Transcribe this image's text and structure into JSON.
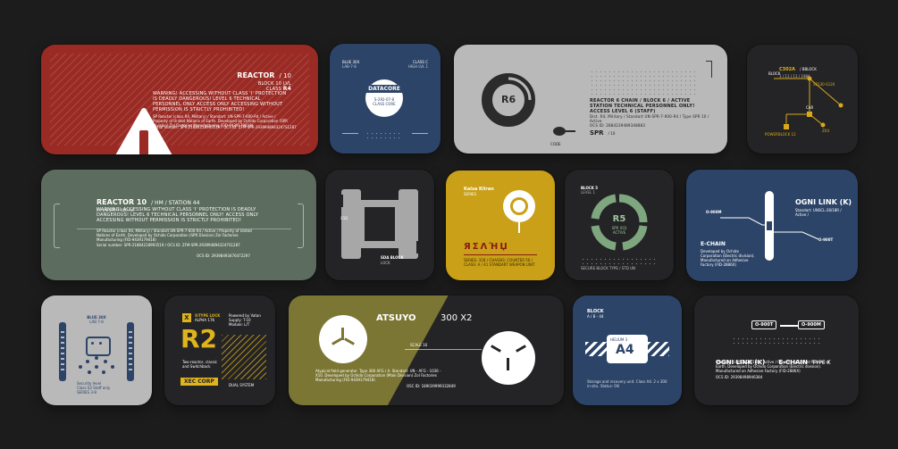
{
  "colors": {
    "background": "#1c1c1d",
    "red": "#9a2a24",
    "navy": "#2c4468",
    "gray": "#b9b9b9",
    "dark": "#242426",
    "green": "#5c6c5e",
    "yellow": "#c9a017",
    "olive": "#7b7633",
    "white": "#ffffff"
  },
  "card1": {
    "title": "REACTOR",
    "title_num": "/ 10",
    "sub1": "BLOCK 10 LVL",
    "sub2": "CLASS",
    "class_val": "R4",
    "warning": "WARNING! ACCESSING WITHOUT CLASS 'I' PROTECTION IS DEADLY DANGEROUS! LEVEL 6 TECHNICAL PERSONNEL ONLY ACCESS ONLY ACCESSING WITHOUT PERMISSION IS STRICTLY PROHIBITED!",
    "body": "SP Reactor (class R4, Military) / Standart: UN-SPR-7-600-R4 / Active / Property of United Nations of Earth. Developed by Ochido Corporation (SPR Division) Zol Factories Manufacturing (FID-9439179418)",
    "serial": "Serial number: SPR-21884218993519 / OCS ID: ZFM-SPR-2939948943247S1287"
  },
  "card2": {
    "tl": "BLUE 30X",
    "tl2": "LAB-7-8",
    "tr": "CLASS C",
    "tr2": "HIGH LVL 1",
    "title": "DATACORE",
    "code": "S-292-07-8",
    "code2": "CLASS CORE"
  },
  "card3": {
    "label": "R6",
    "side": "CODE",
    "header": "REACTOR 6 CHAIN / BLOCK 6 / ACTIVE",
    "line1": "STATION TECHNICAL PERSONNEL ONLY! ACCESS LEVEL 6 (STAFF)",
    "line2": "Dist. R4, Military / Standart UN-SPR-7-600-R4 / Type SPR 10 / Active",
    "line3": "OCS ID: 2884239489348883",
    "brand": "SPR",
    "brand_num": "/ 10"
  },
  "card4": {
    "title": "C302A",
    "title2": "/ BBLOCK",
    "sub": "1 / 11 | 11 / 1984",
    "n1": "BLOCK",
    "n2": "S5530-S120",
    "n3": "CAR",
    "n4": "POWERBLOCK 12",
    "n5": "ZX4"
  },
  "card5": {
    "title": "REACTOR 10",
    "title_tail": "/ HM / STATION 44",
    "sub": "R / UN-SPR-7-600-R4",
    "warning": "WARNING! ACCESSING WITHOUT CLASS 'I' PROTECTION IS DEADLY DANGEROUS! LEVEL 6 TECHNICAL PERSONNEL ONLY! ACCESS ONLY ACCESSING WITHOUT PERMISSION IS STRICTLY PROHIBITED!",
    "body": "SP Reactor (class R4, Military) / Standart UN-SPR-7-600-R4 / Active / Property of United Nations of Earth. Developed by Ochido Corporation (SPR Division) Zol Factories Manufacturing (FID-9439179418)",
    "serial": "Serial number: SPR-21884218993519 / OCS ID: ZFM-SPR-2939948943247S1287",
    "ocs": "OCS ID: 29398493476472297"
  },
  "card6": {
    "side": "X1D",
    "label": "SDA BLOCK",
    "label2": "LOCK"
  },
  "card7": {
    "title": "Kalsa Kliran",
    "sub": "SERIES",
    "glyphs": "ЯΣΛΉЏ",
    "caption": "SERIES: 31B / CHASSIS: COUNTER 56 / CLASS: A / 41 STANDART WEAPON UNIT"
  },
  "card8": {
    "block": "BLOCK 5",
    "block_sub": "LEVEL 1",
    "title": "R5",
    "sub1": "SPR X03",
    "sub2": "ACTIVE",
    "footer": "SECURE BLOCK TYPE / STD UN"
  },
  "card9": {
    "title": "OGNI LINK (K)",
    "sub": "Standart: UNSCL-28/18R / Active /",
    "n1": "O-900M",
    "n2": "O-900T",
    "e": "E-CHAIN",
    "body": "Developed by Ochido Corporation (Electric division). Manufactured on Adhesive Factory (FID-2886X)"
  },
  "card10": {
    "title": "BLUE 30X",
    "sub": "LAB 7-8",
    "foot1": "Security level",
    "foot2": "Class S2 Staff only",
    "foot3": "SERIES 3-8"
  },
  "card11": {
    "badge": "X",
    "tag": "X-TYPE LOCK",
    "tag2": "ALPHA 17K",
    "r1": "Powered by Vatan",
    "r2": "Supply: T-10",
    "r3": "Module: L/T",
    "title": "R2",
    "desc": "Two-reactor, classic and Switchback",
    "btn": "XEC CORP",
    "small": "DUAL SYSTEM"
  },
  "card12": {
    "title": "ATSUYO",
    "num": "300 X2",
    "tag": "SCALE 16",
    "body": "Atypical field generator. Type 300 AFG / A. Standart: UN - AFG - 1036 - X10. Developed by Ochido Corporation (Main Division) Zol Factories Manufacturing (FID-9439179418)",
    "ocs": "OSC ID: 189039999332849"
  },
  "card13": {
    "title": "BLOCK",
    "sub": "A / B - 44",
    "label": "A4",
    "tag": "HELIUM 3",
    "foot": "Storage and recovery unit. Class A4. 2 x 300 in-situ. Status: OK"
  },
  "card14": {
    "b1": "O-900T",
    "b2": "O-900M",
    "title": "OGNI LINK (K)",
    "e": "E-CHAIN",
    "type": "TYPE K",
    "body": "Standart: UNSCL-28/18R / Active / Property of United Nations of Earth. Developed by Ochido Corporation (Electric division). Manufactured on Adhesive Factory (FID-2886X)",
    "ocs": "OCS ID: 29398498946384"
  }
}
